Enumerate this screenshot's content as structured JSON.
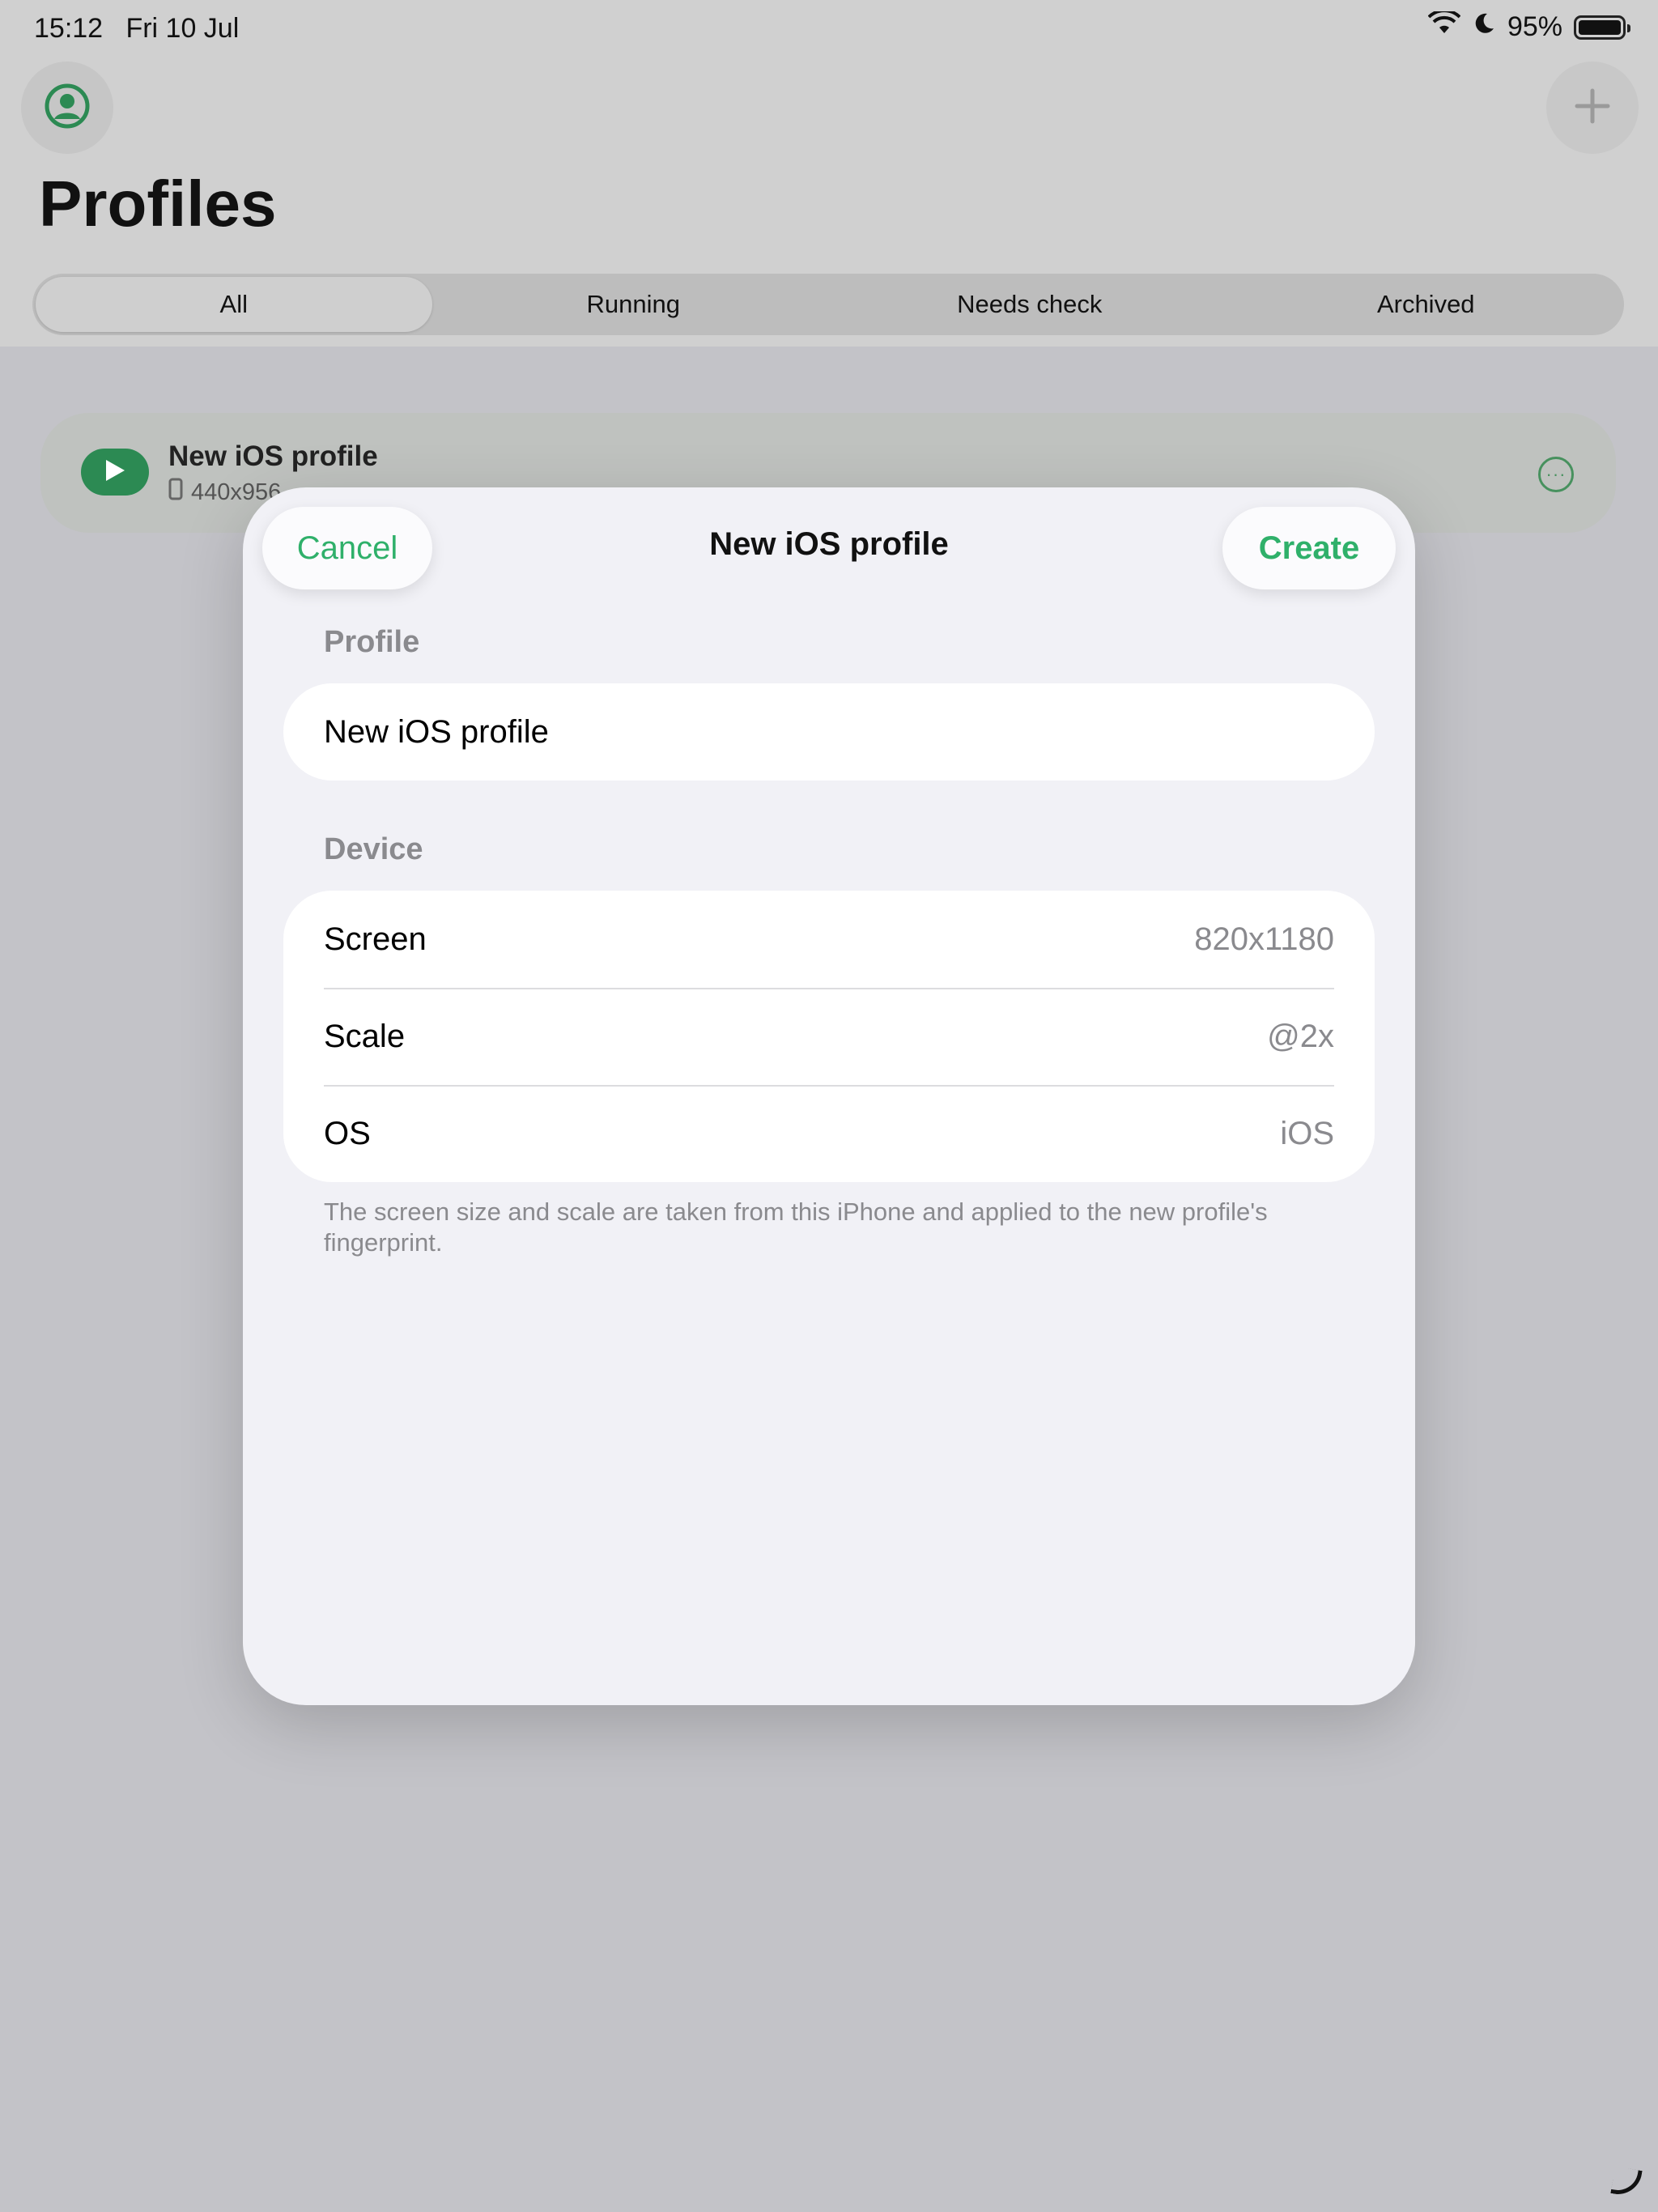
{
  "status_bar": {
    "time": "15:12",
    "date": "Fri 10 Jul",
    "battery": "95%"
  },
  "page": {
    "title": "Profiles"
  },
  "filters": [
    "All",
    "Running",
    "Needs check",
    "Archived"
  ],
  "profile_card": {
    "name": "New iOS profile",
    "screen": "440x956"
  },
  "sheet": {
    "title": "New iOS profile",
    "cancel_label": "Cancel",
    "create_label": "Create",
    "profile_section_label": "Profile",
    "profile_name_value": "New iOS profile",
    "device_section_label": "Device",
    "device_rows": [
      {
        "label": "Screen",
        "value": "820x1180"
      },
      {
        "label": "Scale",
        "value": "@2x"
      },
      {
        "label": "OS",
        "value": "iOS"
      }
    ],
    "footnote": "The screen size and scale are taken from this iPhone and applied to the new profile's fingerprint."
  },
  "colors": {
    "accent": "#2fb06a",
    "dimmed_background": "#c3c3c8",
    "sheet_background": "#f1f1f6"
  }
}
